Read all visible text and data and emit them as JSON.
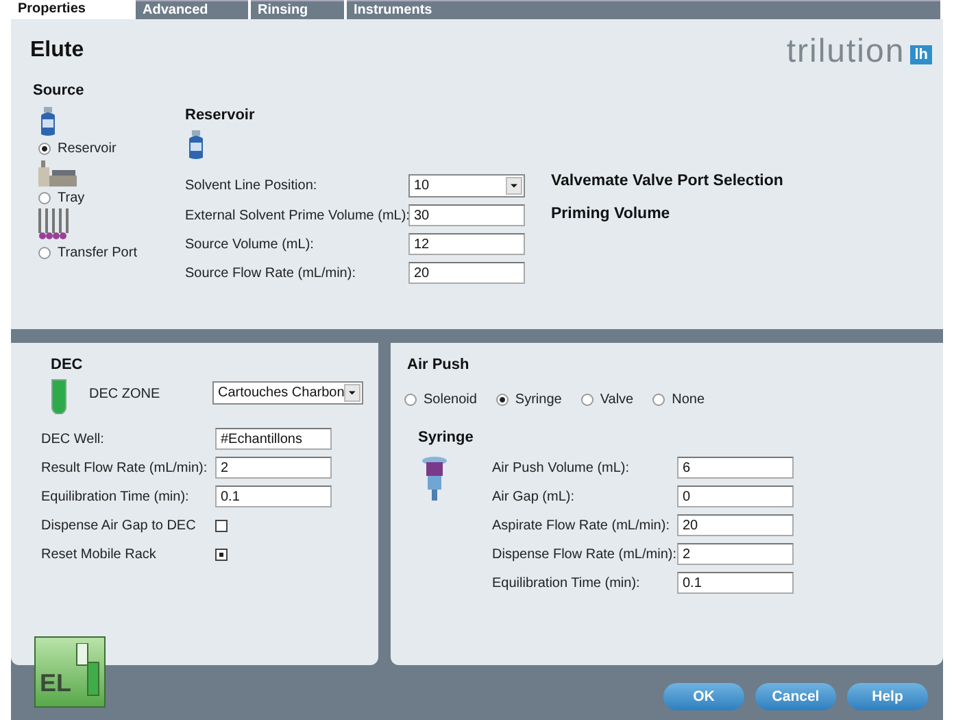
{
  "tabs": [
    {
      "label": "Properties",
      "selected": true
    },
    {
      "label": "Advanced",
      "selected": false
    },
    {
      "label": "Rinsing",
      "selected": false
    },
    {
      "label": "Instruments",
      "selected": false
    }
  ],
  "title": "Elute",
  "logo": {
    "wordmark": "trilution",
    "badge": "lh"
  },
  "source": {
    "heading": "Source",
    "options": [
      {
        "label": "Reservoir",
        "kind": "bottle",
        "selected": true
      },
      {
        "label": "Tray",
        "kind": "tray",
        "selected": false
      },
      {
        "label": "Transfer Port",
        "kind": "tubes",
        "selected": false
      }
    ],
    "reservoir": {
      "heading": "Reservoir",
      "fields": [
        {
          "label": "Solvent Line Position:",
          "value": "10",
          "kind": "dropdown"
        },
        {
          "label": "External Solvent Prime Volume (mL):",
          "value": "30",
          "kind": "text"
        },
        {
          "label": "Source Volume (mL):",
          "value": "12",
          "kind": "text"
        },
        {
          "label": "Source Flow Rate (mL/min):",
          "value": "20",
          "kind": "text"
        }
      ]
    },
    "notes": [
      "Valvemate Valve Port Selection",
      "Priming Volume"
    ]
  },
  "dec": {
    "heading": "DEC",
    "zone_label": "DEC ZONE",
    "zone_value": "Cartouches Charbon",
    "fields": [
      {
        "label": "DEC Well:",
        "value": "#Echantillons",
        "kind": "text"
      },
      {
        "label": "Result Flow Rate (mL/min):",
        "value": "2",
        "kind": "text"
      },
      {
        "label": "Equilibration Time (min):",
        "value": "0.1",
        "kind": "text"
      },
      {
        "label": "Dispense Air Gap to DEC",
        "checked": false,
        "kind": "checkbox"
      },
      {
        "label": "Reset Mobile Rack",
        "checked": true,
        "kind": "checkbox"
      }
    ]
  },
  "air_push": {
    "heading": "Air Push",
    "modes": [
      {
        "label": "Solenoid",
        "selected": false
      },
      {
        "label": "Syringe",
        "selected": true
      },
      {
        "label": "Valve",
        "selected": false
      },
      {
        "label": "None",
        "selected": false
      }
    ],
    "syringe": {
      "heading": "Syringe",
      "fields": [
        {
          "label": "Air Push Volume (mL):",
          "value": "6"
        },
        {
          "label": "Air Gap (mL):",
          "value": "0"
        },
        {
          "label": "Aspirate Flow Rate (mL/min):",
          "value": "20"
        },
        {
          "label": "Dispense Flow Rate (mL/min):",
          "value": "2"
        },
        {
          "label": "Equilibration Time (min):",
          "value": "0.1"
        }
      ]
    }
  },
  "app_badge": "EL",
  "buttons": [
    "OK",
    "Cancel",
    "Help"
  ]
}
